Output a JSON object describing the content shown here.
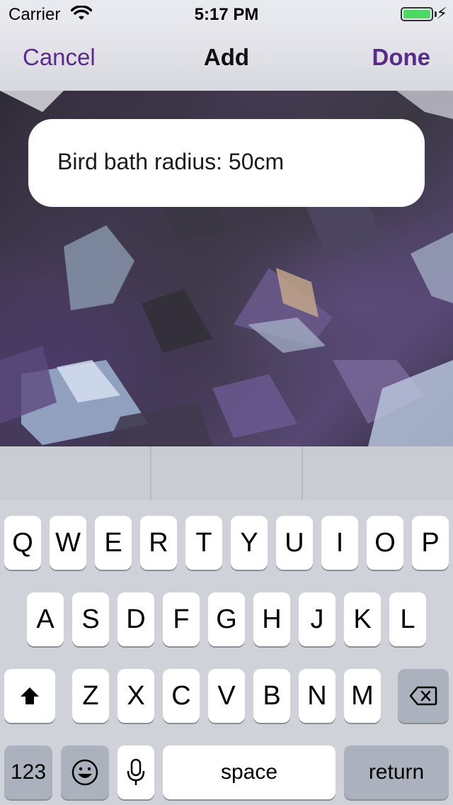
{
  "status_bar": {
    "carrier": "Carrier",
    "time": "5:17 PM",
    "battery_level": 1.0,
    "battery_color": "#4cd964",
    "charging_icon": "⚡"
  },
  "nav": {
    "cancel_label": "Cancel",
    "title": "Add",
    "done_label": "Done",
    "accent_color": "#5a2a8c"
  },
  "field": {
    "text": "Bird bath radius: 50cm"
  },
  "keyboard": {
    "row1": [
      "Q",
      "W",
      "E",
      "R",
      "T",
      "Y",
      "U",
      "I",
      "O",
      "P"
    ],
    "row2": [
      "A",
      "S",
      "D",
      "F",
      "G",
      "H",
      "J",
      "K",
      "L"
    ],
    "row3": [
      "Z",
      "X",
      "C",
      "V",
      "B",
      "N",
      "M"
    ],
    "numbers_label": "123",
    "space_label": "space",
    "return_label": "return",
    "icons": [
      "shift-icon",
      "delete-icon",
      "emoji-icon",
      "microphone-icon"
    ]
  }
}
